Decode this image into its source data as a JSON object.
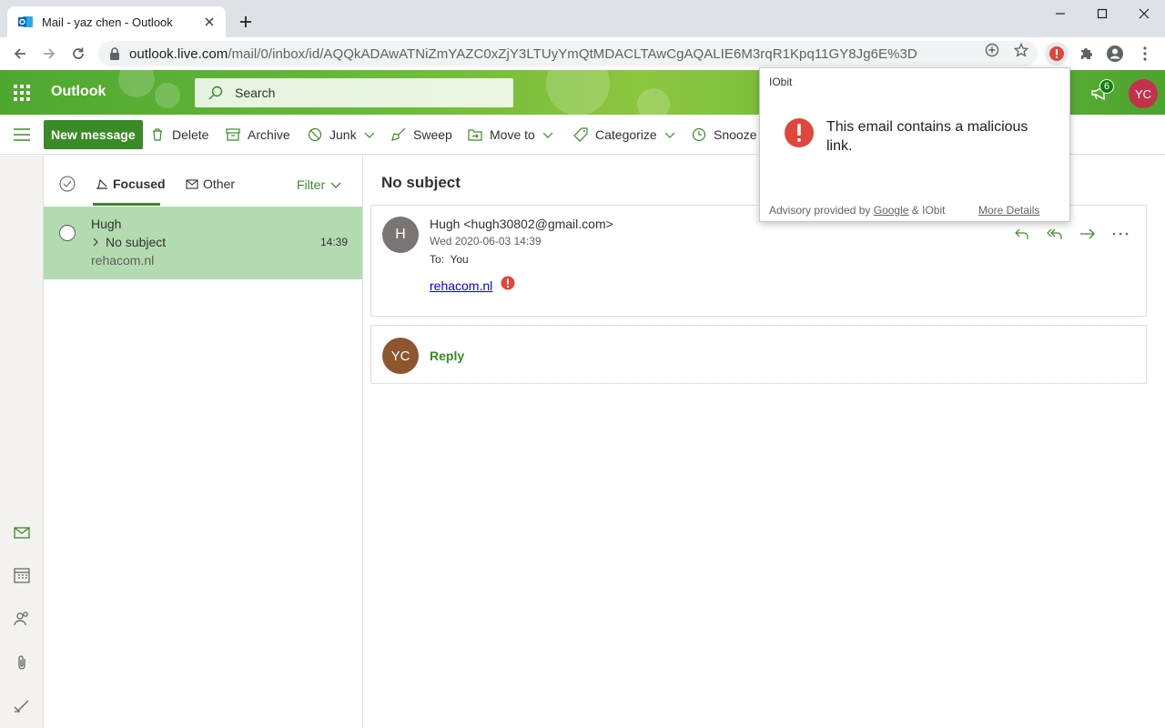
{
  "browser": {
    "tab_title": "Mail - yaz chen - Outlook",
    "url_host": "outlook.live.com",
    "url_path": "/mail/0/inbox/id/AQQkADAwATNiZmYAZC0xZjY3LTUyYmQtMDACLTAwCgAQALIE6M3rqR1Kpq11GY8Jg6E%3D"
  },
  "header": {
    "brand": "Outlook",
    "search_placeholder": "Search",
    "notification_count": "6",
    "user_initials": "YC"
  },
  "commands": {
    "new_message": "New message",
    "delete": "Delete",
    "archive": "Archive",
    "junk": "Junk",
    "sweep": "Sweep",
    "move_to": "Move to",
    "categorize": "Categorize",
    "snooze": "Snooze"
  },
  "list": {
    "tab_focused": "Focused",
    "tab_other": "Other",
    "filter": "Filter",
    "messages": [
      {
        "from": "Hugh",
        "subject": "No subject",
        "preview": "rehacom.nl",
        "time": "14:39"
      }
    ]
  },
  "reading": {
    "subject": "No subject",
    "sender_initial": "H",
    "sender": "Hugh <hugh30802@gmail.com>",
    "date": "Wed 2020-06-03 14:39",
    "to_label": "To:",
    "to_value": "You",
    "body_link": "rehacom.nl",
    "reply_initials": "YC",
    "reply_label": "Reply"
  },
  "popup": {
    "brand": "IObit",
    "message": "This email contains a malicious link.",
    "advisory_prefix": "Advisory provided by",
    "advisory_google": "Google",
    "advisory_suffix": "& IObit",
    "more_details": "More Details"
  },
  "colors": {
    "accent": "#3a8a28",
    "selected_row": "#b3dbb1",
    "alert_red": "#e0463c"
  }
}
